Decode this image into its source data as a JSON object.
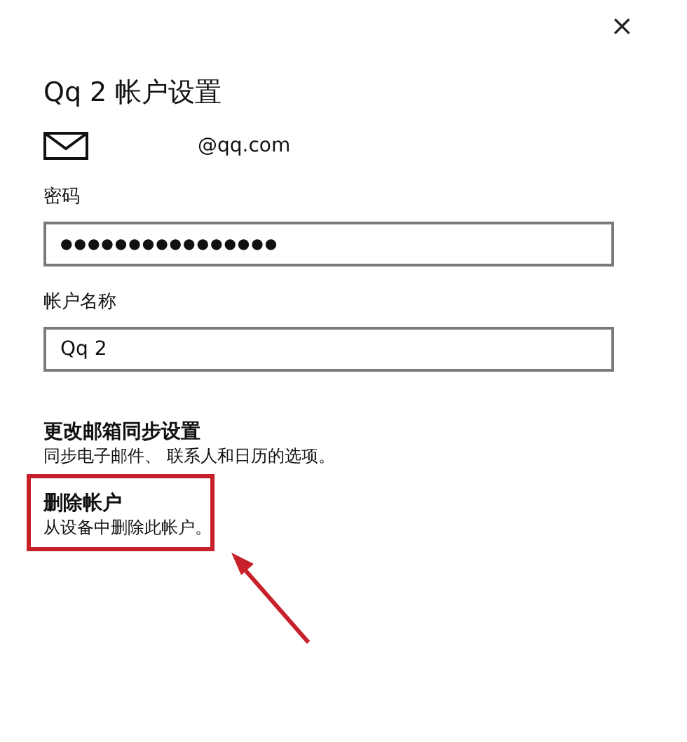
{
  "close": "×",
  "title": "Qq 2 帐户设置",
  "email": "@qq.com",
  "fields": [
    {
      "label": "密码",
      "kind": "password",
      "value": "●●●●●●●●●●●●●●●●"
    },
    {
      "label": "帐户名称",
      "kind": "text",
      "value": "Qq 2"
    }
  ],
  "options": [
    {
      "title": "更改邮箱同步设置",
      "subtitle": "同步电子邮件、 联系人和日历的选项。",
      "highlighted": false
    },
    {
      "title": "删除帐户",
      "subtitle": "从设备中删除此帐户。",
      "highlighted": true
    }
  ]
}
